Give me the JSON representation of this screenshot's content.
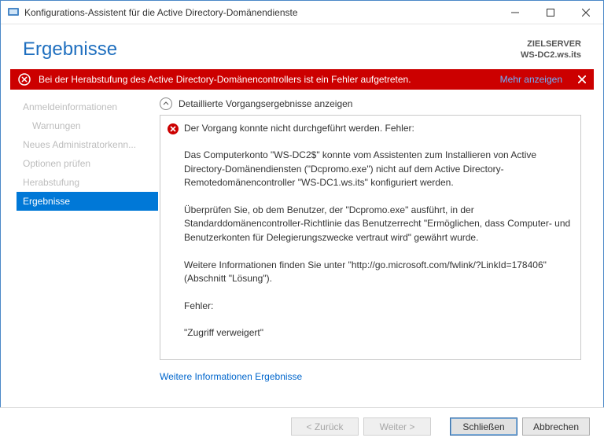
{
  "window": {
    "title": "Konfigurations-Assistent für die Active Directory-Domänendienste"
  },
  "header": {
    "heading": "Ergebnisse",
    "target_label": "ZIELSERVER",
    "target_name": "WS-DC2.ws.its"
  },
  "error_bar": {
    "message": "Bei der Herabstufung des Active Directory-Domänencontrollers ist ein Fehler aufgetreten.",
    "more_label": "Mehr anzeigen"
  },
  "sidebar": {
    "steps": [
      {
        "label": "Anmeldeinformationen",
        "sub": false
      },
      {
        "label": "Warnungen",
        "sub": true
      },
      {
        "label": "Neues Administratorkenn...",
        "sub": false
      },
      {
        "label": "Optionen prüfen",
        "sub": false
      },
      {
        "label": "Herabstufung",
        "sub": false
      },
      {
        "label": "Ergebnisse",
        "sub": false,
        "active": true
      }
    ]
  },
  "details": {
    "toggle_label": "Detaillierte Vorgangsergebnisse anzeigen",
    "heading": "Der Vorgang konnte nicht durchgeführt werden. Fehler:",
    "body": "Das Computerkonto \"WS-DC2$\" konnte vom Assistenten zum Installieren von Active Directory-Domänendiensten (\"Dcpromo.exe\") nicht auf dem Active Directory-Remotedomänencontroller \"WS-DC1.ws.its\" konfiguriert werden.\n\nÜberprüfen Sie, ob dem Benutzer, der \"Dcpromo.exe\" ausführt, in der Standarddomänencontroller-Richtlinie das Benutzerrecht \"Ermöglichen, dass Computer- und Benutzerkonten für Delegierungszwecke vertraut wird\" gewährt wurde.\n\nWeitere Informationen finden Sie unter \"http://go.microsoft.com/fwlink/?LinkId=178406\" (Abschnitt \"Lösung\").\n\nFehler:\n\n\"Zugriff verweigert\""
  },
  "links": {
    "more_info_results": "Weitere Informationen Ergebnisse"
  },
  "buttons": {
    "back": "< Zurück",
    "next": "Weiter >",
    "close": "Schließen",
    "cancel": "Abbrechen"
  }
}
